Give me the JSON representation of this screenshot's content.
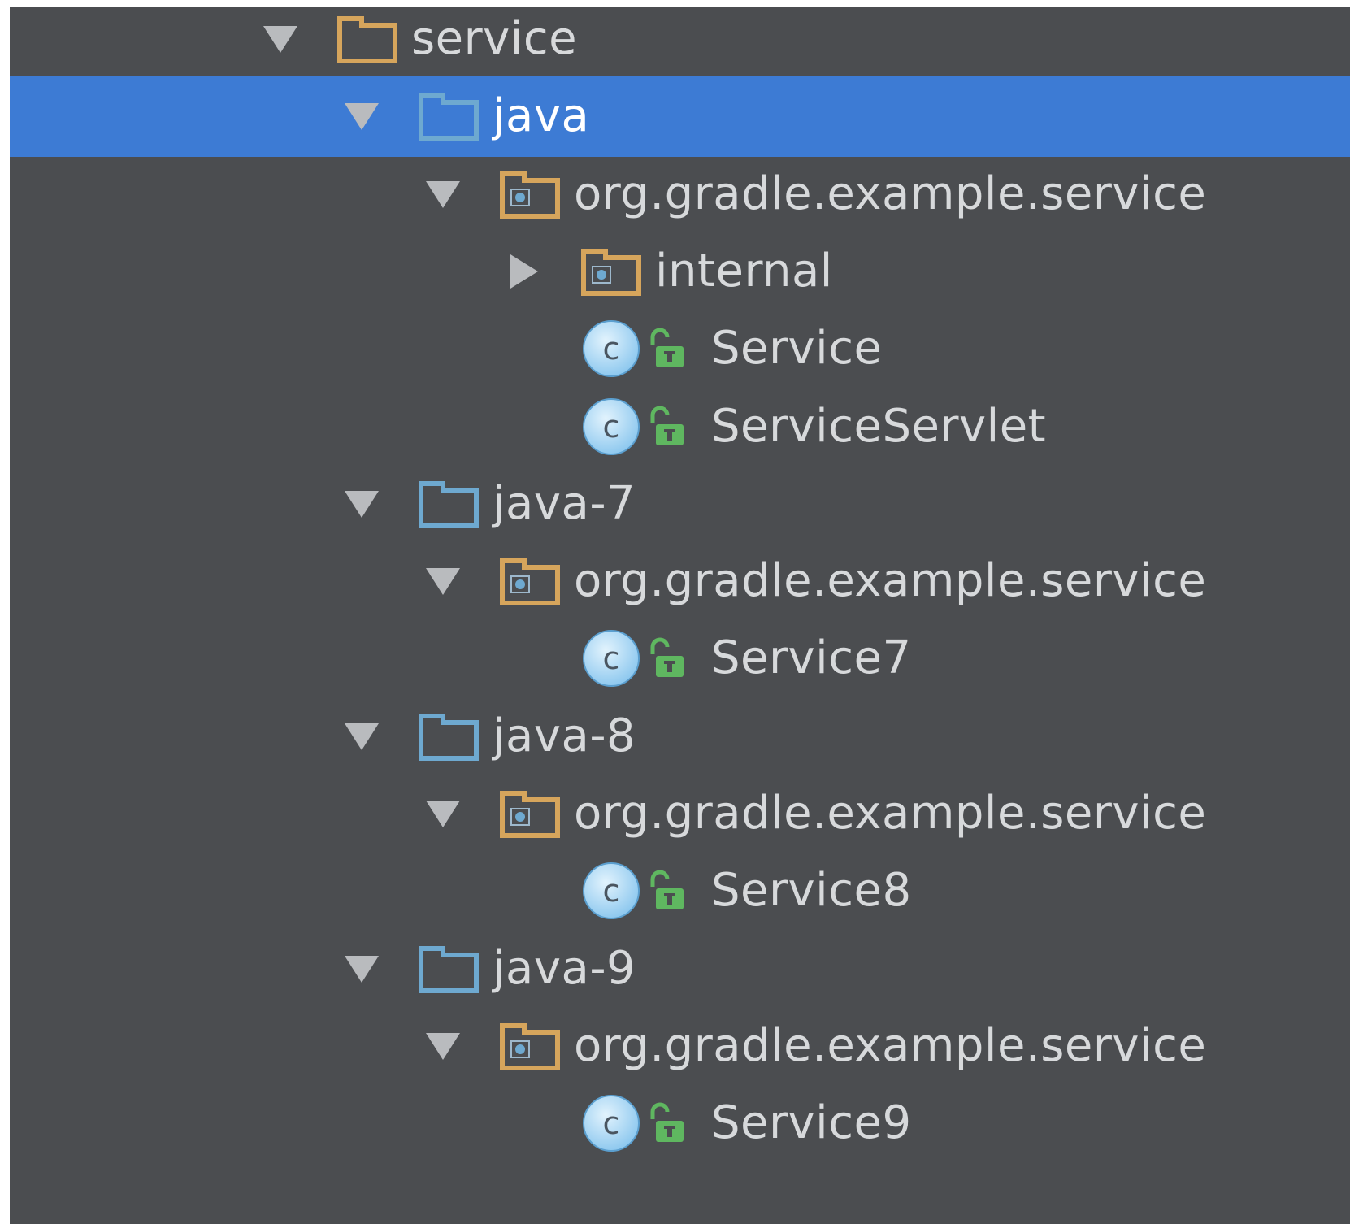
{
  "tree": {
    "rows": [
      {
        "label": "service",
        "depth": 0,
        "expander": "down",
        "icon": "module-folder-icon",
        "selected": false
      },
      {
        "label": "java",
        "depth": 1,
        "expander": "down",
        "icon": "source-root-folder-icon",
        "selected": true
      },
      {
        "label": "org.gradle.example.service",
        "depth": 2,
        "expander": "down",
        "icon": "package-folder-icon",
        "selected": false
      },
      {
        "label": "internal",
        "depth": 3,
        "expander": "right",
        "icon": "package-folder-icon",
        "selected": false
      },
      {
        "label": "Service",
        "depth": 4,
        "expander": "none",
        "icon": "class-icon",
        "lock": true,
        "selected": false
      },
      {
        "label": "ServiceServlet",
        "depth": 4,
        "expander": "none",
        "icon": "class-icon",
        "lock": true,
        "selected": false
      },
      {
        "label": "java-7",
        "depth": 1,
        "expander": "down",
        "icon": "source-root-folder-icon",
        "selected": false
      },
      {
        "label": "org.gradle.example.service",
        "depth": 2,
        "expander": "down",
        "icon": "package-folder-icon",
        "selected": false
      },
      {
        "label": "Service7",
        "depth": 4,
        "expander": "none",
        "icon": "class-icon",
        "lock": true,
        "selected": false
      },
      {
        "label": "java-8",
        "depth": 1,
        "expander": "down",
        "icon": "source-root-folder-icon",
        "selected": false
      },
      {
        "label": "org.gradle.example.service",
        "depth": 2,
        "expander": "down",
        "icon": "package-folder-icon",
        "selected": false
      },
      {
        "label": "Service8",
        "depth": 4,
        "expander": "none",
        "icon": "class-icon",
        "lock": true,
        "selected": false
      },
      {
        "label": "java-9",
        "depth": 1,
        "expander": "down",
        "icon": "source-root-folder-icon",
        "selected": false
      },
      {
        "label": "org.gradle.example.service",
        "depth": 2,
        "expander": "down",
        "icon": "package-folder-icon",
        "selected": false
      },
      {
        "label": "Service9",
        "depth": 4,
        "expander": "none",
        "icon": "class-icon",
        "lock": true,
        "selected": false
      }
    ]
  },
  "colors": {
    "panel_bg": "#4b4d50",
    "selection_bg": "#3d7bd4",
    "text": "#d7d9db",
    "module_folder": "#d6a55c",
    "source_folder": "#6ea9d0",
    "class_icon": "#8fc9ef",
    "lock": "#5fb760",
    "arrow": "#b9bbbe"
  }
}
